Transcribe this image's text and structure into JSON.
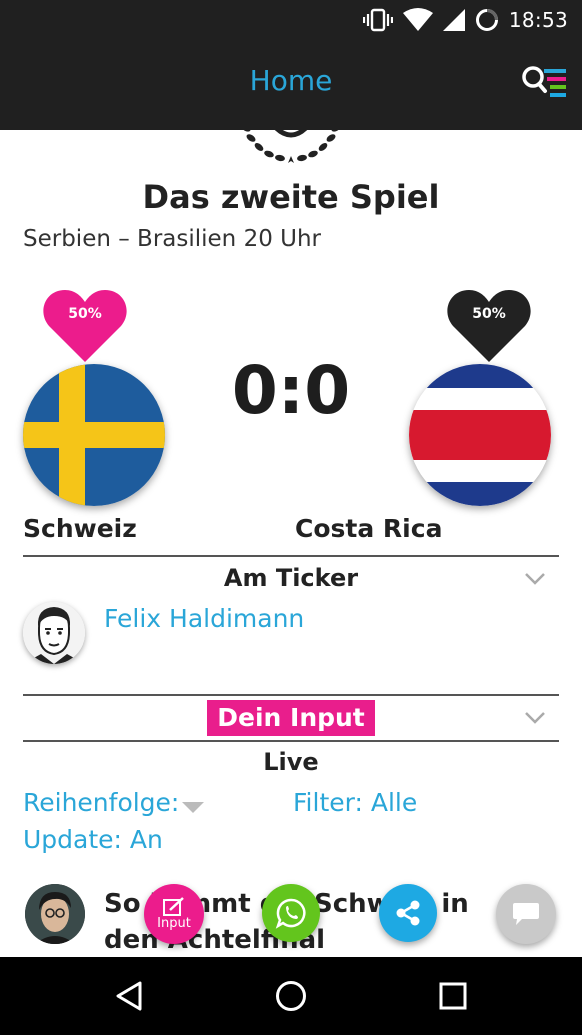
{
  "status_bar": {
    "time": "18:53",
    "icons": [
      "vibrate-icon",
      "wifi-icon",
      "signal-icon",
      "battery-icon"
    ]
  },
  "app_bar": {
    "title": "Home",
    "menu_icon": "search-menu-icon"
  },
  "game": {
    "title": "Das zweite Spiel",
    "subtitle": "Serbien – Brasilien 20 Uhr",
    "score": "0:0",
    "home": {
      "name": "Schweiz",
      "vote": "50%",
      "heart_color": "#ec1c8c",
      "flag": "sweden"
    },
    "away": {
      "name": "Costa Rica",
      "vote": "50%",
      "heart_color": "#222222",
      "flag": "costa-rica"
    }
  },
  "ticker": {
    "title": "Am Ticker",
    "author": "Felix Haldimann"
  },
  "input_section": {
    "label": "Dein Input"
  },
  "live": {
    "title": "Live",
    "sort_label": "Reihenfolge:",
    "filter_label": "Filter: Alle",
    "update_label": "Update: An"
  },
  "post": {
    "title": "So kommt die Schweiz in den Achtelfinal"
  },
  "fabs": {
    "input_label": "Input"
  },
  "colors": {
    "accent": "#2aa6d8",
    "pink": "#ec1c8c",
    "whatsapp": "#63c51d",
    "share": "#1ea9e3",
    "bar": "#202020"
  }
}
